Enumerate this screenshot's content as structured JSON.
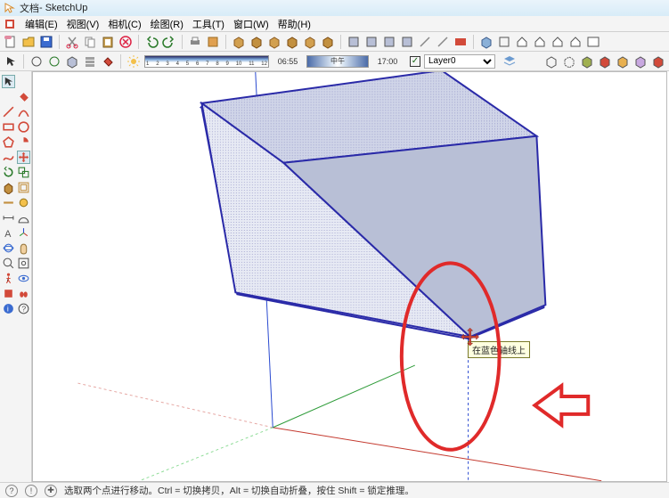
{
  "app": {
    "title_suffix": " - SketchUp",
    "doc_hint": "文档"
  },
  "menu": {
    "items": [
      "编辑(E)",
      "视图(V)",
      "相机(C)",
      "绘图(R)",
      "工具(T)",
      "窗口(W)",
      "帮助(H)"
    ]
  },
  "timeline": {
    "ticks": [
      "1",
      "2",
      "3",
      "4",
      "5",
      "6",
      "7",
      "8",
      "9",
      "10",
      "11",
      "12"
    ],
    "time_left": "06:55",
    "daypart_label": "中午",
    "time_right": "17:00"
  },
  "layer": {
    "checked": "✓",
    "selected": "Layer0",
    "options": [
      "Layer0"
    ]
  },
  "tooltip": {
    "text": "在蓝色轴线上"
  },
  "status": {
    "hint": "选取两个点进行移动。Ctrl = 切换拷贝，Alt = 切换自动折叠，按住 Shift = 锁定推理。"
  },
  "icons": {
    "toolbar1": [
      "new",
      "open",
      "save",
      "cut",
      "copy",
      "paste",
      "delete",
      "undo",
      "redo",
      "print",
      "model-info",
      "box",
      "box2",
      "cylinder",
      "sphere",
      "cone",
      "prism",
      "layers",
      "layers2",
      "layers3",
      "layers4",
      "arrow",
      "scene",
      "help",
      "home",
      "house",
      "house2",
      "home2",
      "browser"
    ],
    "toolbar2": [
      "select",
      "hand",
      "orbit",
      "cube",
      "layers-panel",
      "paint",
      "sun"
    ],
    "toolbar2_right": [
      "style1",
      "style2",
      "style3",
      "style4",
      "style5",
      "style6",
      "style7"
    ],
    "leftTools": [
      [
        "pointer",
        ""
      ],
      [
        "eraser",
        "pencil"
      ],
      [
        "line",
        "arc"
      ],
      [
        "rect",
        "circle"
      ],
      [
        "poly",
        "pie"
      ],
      [
        "freehand",
        "move"
      ],
      [
        "rotate",
        "scale"
      ],
      [
        "pushpull",
        "offset"
      ],
      [
        "follow",
        "tape"
      ],
      [
        "tape2",
        "protractor"
      ],
      [
        "dimension",
        "text"
      ],
      [
        "axes",
        "section"
      ],
      [
        "walk",
        "look"
      ],
      [
        "position",
        "feet"
      ],
      [
        "i",
        "help2"
      ]
    ]
  },
  "colors": {
    "cube_front": "#e7eaf4",
    "cube_right": "#b8bfd6",
    "cube_top": "#d0d5e8",
    "cube_edge": "#2a2aa8",
    "axis_red": "#c43a2f",
    "axis_green": "#2f9c3a",
    "axis_blue": "#2a4ad0",
    "annotation_red": "#e02a2a"
  }
}
